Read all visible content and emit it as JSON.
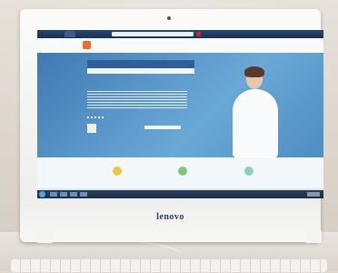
{
  "monitor": {
    "brand": "lenovo"
  },
  "screen": {
    "browser_tab": "",
    "site_name": ""
  },
  "colors": {
    "brand_text": "#2e3b66",
    "logo_badge": "#ef6a2a",
    "feature_icon_1": "#e9c547",
    "feature_icon_2": "#7fc87a",
    "feature_icon_3": "#8fd0bd"
  }
}
